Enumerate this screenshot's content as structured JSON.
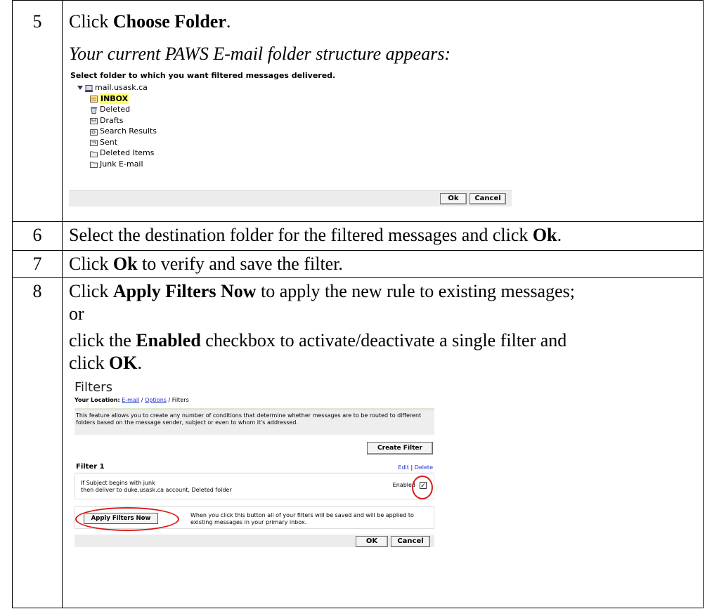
{
  "rows": [
    {
      "num": "5",
      "intro_pre": "Click ",
      "intro_bold": "Choose Folder",
      "intro_post": ".",
      "italic": "Your current PAWS E-mail folder structure appears:"
    },
    {
      "num": "6",
      "pre": "Select the destination folder for the filtered messages and click ",
      "bold": "Ok",
      "post": "."
    },
    {
      "num": "7",
      "pre": "Click ",
      "bold": "Ok",
      "post": " to verify and save the filter."
    },
    {
      "num": "8",
      "l1_pre": "Click ",
      "l1_bold": "Apply Filters Now",
      "l1_post": " to apply the new rule to existing messages;",
      "l2": "or",
      "l3_pre": "click the ",
      "l3_bold": "Enabled",
      "l3_post": " checkbox to activate/deactivate a single filter and",
      "l4_pre": "click ",
      "l4_bold": "OK",
      "l4_post": "."
    }
  ],
  "folder_picker": {
    "heading": "Select folder to which you want filtered messages delivered.",
    "root": "mail.usask.ca",
    "folders": [
      "INBOX",
      "Deleted",
      "Drafts",
      "Search Results",
      "Sent",
      "Deleted Items",
      "Junk E-mail"
    ],
    "ok_label": "Ok",
    "cancel_label": "Cancel"
  },
  "filters_screen": {
    "title": "Filters",
    "location_label": "Your Location:",
    "crumb_email": "E-mail",
    "crumb_options": "Options",
    "crumb_current": "Filters",
    "crumb_sep": "/",
    "description": "This feature allows you to create any number of conditions that determine whether messages are to be routed to different folders based on the message sender, subject or even to whom it's addressed.",
    "create_label": "Create Filter",
    "filter_name": "Filter 1",
    "edit_label": "Edit",
    "link_sep": "|",
    "delete_label": "Delete",
    "rule_line1": "If  Subject  begins with  junk",
    "rule_line2": "then deliver to duke.usask.ca account, Deleted folder",
    "enabled_label": "Enabled",
    "enabled_checked": true,
    "apply_label": "Apply Filters Now",
    "apply_note": "When you click this button all of your filters will be saved and will be applied to existing messages in your primary inbox.",
    "ok_label": "OK",
    "cancel_label": "Cancel"
  }
}
